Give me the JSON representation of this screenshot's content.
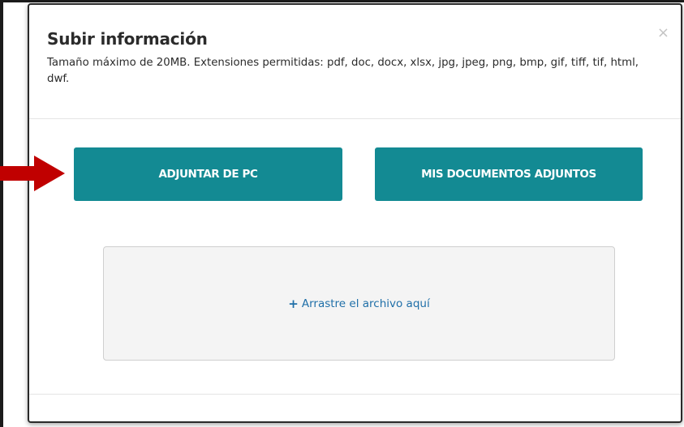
{
  "modal": {
    "title": "Subir información",
    "subtitle": "Tamaño máximo de 20MB. Extensiones permitidas: pdf, doc, docx, xlsx, jpg, jpeg, png, bmp, gif, tiff, tif, html, dwf.",
    "close_icon": "×"
  },
  "actions": {
    "attach_pc_label": "ADJUNTAR DE PC",
    "my_documents_label": "MIS DOCUMENTOS ADJUNTOS"
  },
  "dropzone": {
    "plus_icon": "+",
    "label": "Arrastre el archivo aquí"
  },
  "colors": {
    "primary_button": "#138a93",
    "link_blue": "#1f6fa8",
    "arrow_red": "#c00000"
  },
  "icons": {
    "annotation_arrow": "arrow-right-icon",
    "close": "close-icon",
    "add": "plus-icon"
  }
}
